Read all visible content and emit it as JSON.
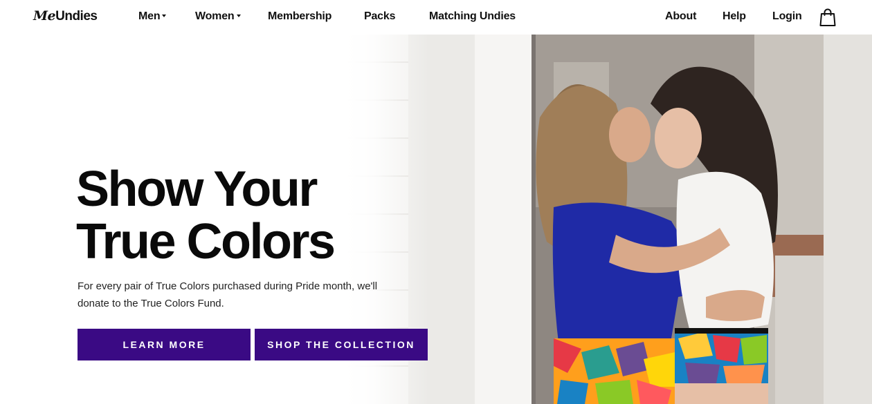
{
  "nav": {
    "logo_me": "Me",
    "logo_undies": "Undies",
    "items": [
      {
        "label": "Men",
        "dropdown": true
      },
      {
        "label": "Women",
        "dropdown": true
      },
      {
        "label": "Membership"
      },
      {
        "label": "Packs"
      },
      {
        "label": "Matching Undies"
      }
    ],
    "right": [
      {
        "label": "About"
      },
      {
        "label": "Help"
      },
      {
        "label": "Login"
      }
    ],
    "bag_icon": "shopping-bag-icon"
  },
  "hero": {
    "headline_line1": "Show Your",
    "headline_line2": "True Colors",
    "subtext": "For every pair of True Colors purchased during Pride month, we'll donate to the True Colors Fund.",
    "learn_more": "LEARN MORE",
    "shop_collection": "SHOP THE COLLECTION",
    "button_color": "#3a0a84"
  }
}
